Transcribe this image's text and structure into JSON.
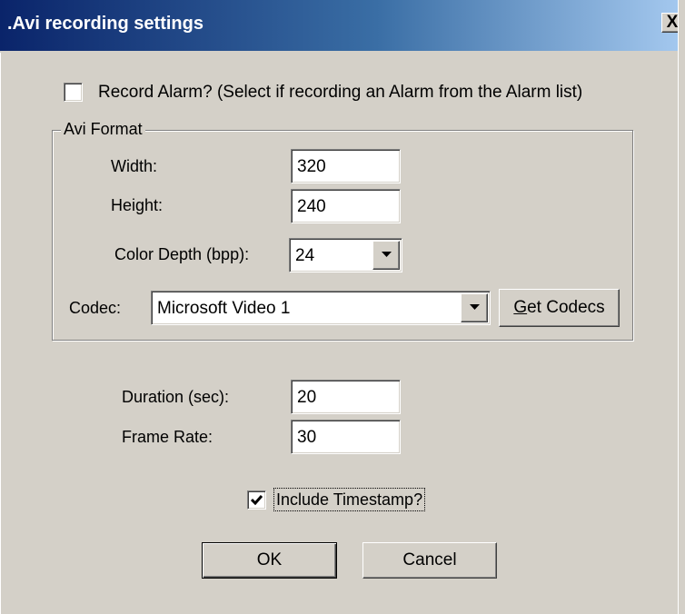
{
  "window": {
    "title": ".Avi recording settings",
    "close_glyph": "X"
  },
  "record_alarm": {
    "label": "Record Alarm? (Select if recording an Alarm from the Alarm list)",
    "checked": false
  },
  "avi_format": {
    "legend": "Avi Format",
    "width_label": "Width:",
    "width_value": "320",
    "height_label": "Height:",
    "height_value": "240",
    "color_depth_label": "Color Depth (bpp):",
    "color_depth_value": "24",
    "codec_label": "Codec:",
    "codec_value": "Microsoft Video 1",
    "get_codecs_mnemonic": "G",
    "get_codecs_rest": "et Codecs"
  },
  "duration_label": "Duration (sec):",
  "duration_value": "20",
  "frame_rate_label": "Frame Rate:",
  "frame_rate_value": "30",
  "include_timestamp": {
    "label": "Include Timestamp?",
    "checked": true
  },
  "buttons": {
    "ok": "OK",
    "cancel": "Cancel"
  },
  "icons": {
    "close": "close-icon",
    "dropdown": "chevron-down-icon",
    "check": "checkmark-icon"
  },
  "colors": {
    "titlebar_start": "#0a246a",
    "titlebar_end": "#a6caf0",
    "face": "#d4d0c8"
  }
}
